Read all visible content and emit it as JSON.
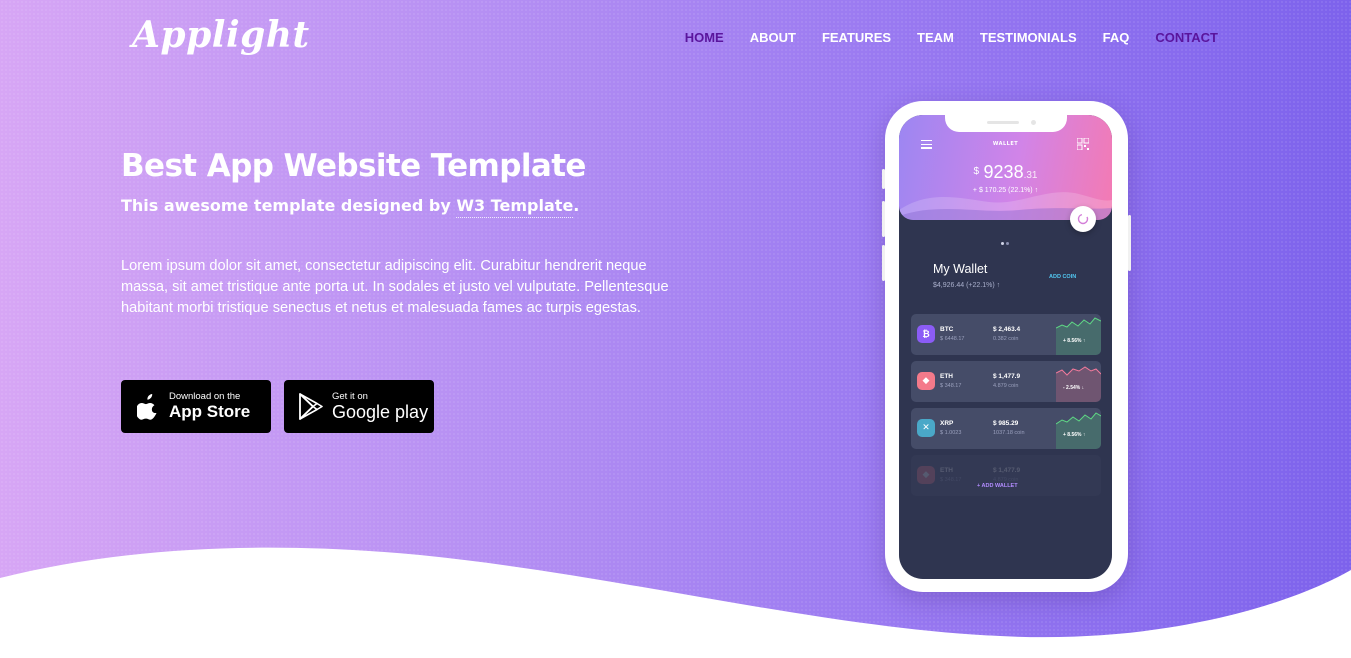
{
  "brand": {
    "logo": "Applight"
  },
  "nav": {
    "items": [
      {
        "label": "HOME"
      },
      {
        "label": "ABOUT"
      },
      {
        "label": "FEATURES"
      },
      {
        "label": "TEAM"
      },
      {
        "label": "TESTIMONIALS"
      },
      {
        "label": "FAQ"
      },
      {
        "label": "CONTACT"
      }
    ]
  },
  "hero": {
    "title": "Best App Website Template",
    "subtitle_prefix": "This awesome template designed by ",
    "subtitle_link": "W3 Template",
    "subtitle_suffix": ".",
    "body": "Lorem ipsum dolor sit amet, consectetur adipiscing elit. Curabitur hendrerit neque massa, sit amet tristique ante porta ut. In sodales et justo vel vulputate. Pellentesque habitant morbi tristique senectus et netus et malesuada fames ac turpis egestas."
  },
  "buttons": {
    "app_store": {
      "small": "Download on the",
      "big": "App Store"
    },
    "google_play": {
      "small": "Get it on",
      "big": "Google play"
    }
  },
  "phone": {
    "screen_title": "WALLET",
    "balance_currency": "$",
    "balance_whole": "9238",
    "balance_decimal": ".31",
    "balance_change": "+ $ 170.25 (22.1%) ↑",
    "wallet_title": "My Wallet",
    "wallet_sub": "$4,926.44 (+22.1%) ↑",
    "add_coin": "ADD COIN",
    "add_wallet": "+ ADD WALLET",
    "coins": [
      {
        "symbol": "BTC",
        "sub": "$ 6448.17",
        "value": "$ 2,463.4",
        "amount": "0.382 coin",
        "pct": "+ 8.56% ↑",
        "icon": "₿",
        "color": "#8b5cf6"
      },
      {
        "symbol": "ETH",
        "sub": "$ 348.17",
        "value": "$ 1,477.9",
        "amount": "4.879 coin",
        "pct": "- 2.54% ↓",
        "icon": "◆",
        "color": "#f47a8a"
      },
      {
        "symbol": "XRP",
        "sub": "$ 1.0023",
        "value": "$ 985.29",
        "amount": "1037.18 coin",
        "pct": "+ 8.56% ↑",
        "icon": "✕",
        "color": "#4aa8c8"
      },
      {
        "symbol": "ETH",
        "sub": "$ 348.17",
        "value": "$ 1,477.9",
        "amount": "4.879 coin",
        "pct": "",
        "icon": "◆",
        "color": "#f47a8a"
      }
    ]
  },
  "colors": {
    "gradient_start": "#d7a6f5",
    "gradient_end": "#7d62ec",
    "nav_active": "#5a159d"
  }
}
